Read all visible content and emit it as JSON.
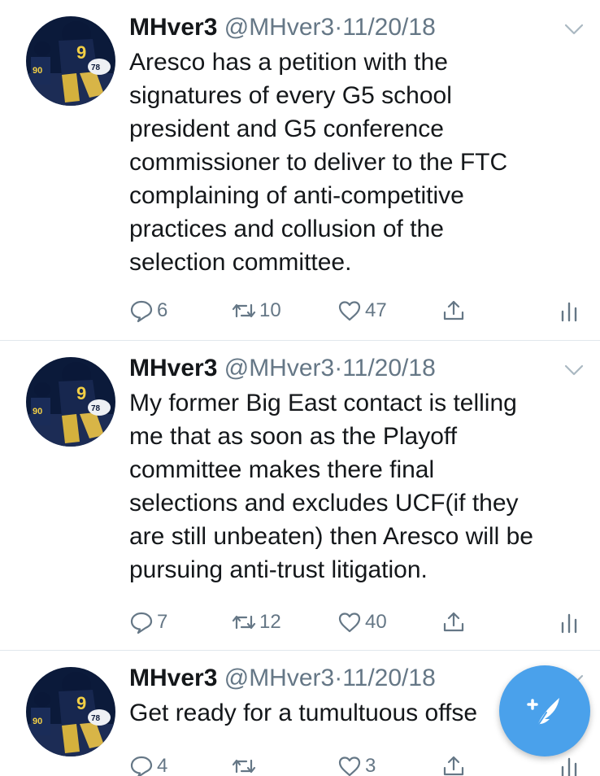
{
  "tweets": [
    {
      "name": "MHver3",
      "handle": "@MHver3",
      "dot": "·",
      "date": "11/20/18",
      "text": "Aresco has a petition with the\nsignatures of every G5 school\npresident and G5 conference\ncommissioner to deliver to the FTC\ncomplaining of anti-competitive\npractices and collusion of the\nselection committee.",
      "replies": "6",
      "retweets": "10",
      "likes": "47"
    },
    {
      "name": "MHver3",
      "handle": "@MHver3",
      "dot": "·",
      "date": "11/20/18",
      "text": "My former Big East contact is telling\nme that as soon as the Playoff\ncommittee makes there final\nselections and excludes UCF(if they\nare still unbeaten) then Aresco will be\npursuing anti-trust litigation.",
      "replies": "7",
      "retweets": "12",
      "likes": "40"
    },
    {
      "name": "MHver3",
      "handle": "@MHver3",
      "dot": "·",
      "date": "11/20/18",
      "text": "Get ready for a tumultuous offse",
      "replies": "4",
      "retweets": "",
      "likes": "3"
    }
  ],
  "icons": {
    "reply": "reply-icon",
    "retweet": "retweet-icon",
    "like": "heart-icon",
    "share": "share-icon",
    "analytics": "analytics-icon",
    "caret": "chevron-down-icon",
    "compose": "compose-tweet-icon"
  },
  "colors": {
    "accent": "#4aa1eb",
    "secondary_text": "#657786",
    "divider": "#e1e8ed"
  }
}
